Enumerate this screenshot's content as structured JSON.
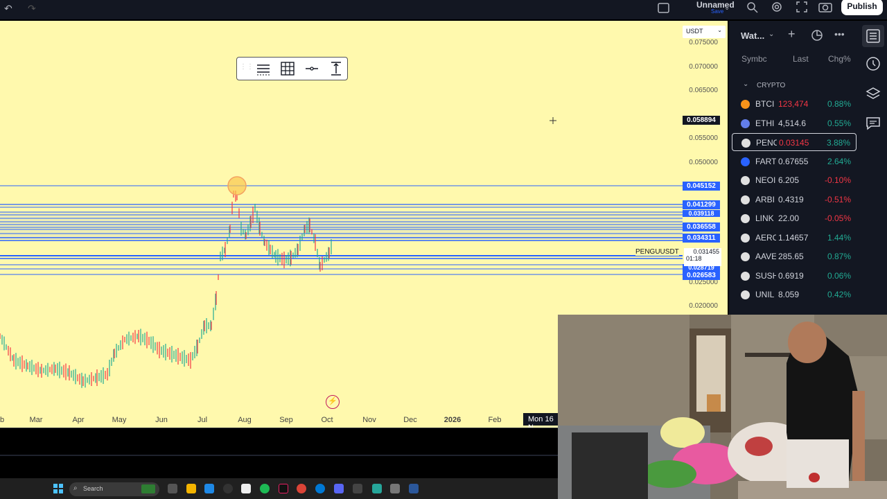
{
  "topbar": {
    "layout_name": "Unnamed",
    "save_label": "Save",
    "publish_label": "Publish",
    "icons": [
      "undo-icon",
      "redo-icon",
      "fullscreen-toggle-icon",
      "chevron-down-icon",
      "search-icon",
      "settings-icon",
      "fullscreen-icon",
      "camera-icon"
    ]
  },
  "chart": {
    "currency": "USDT",
    "symbol": "PENGUUSDT",
    "symbol_price": "0.031455",
    "countdown": "01:18",
    "crosshair_price": "0.058894",
    "crosshair_date": "Mon 16 N",
    "price_ticks": [
      "0.075000",
      "0.070000",
      "0.065000",
      "0.055000",
      "0.050000",
      "0.025000",
      "0.020000"
    ],
    "time_labels": [
      "b",
      "Mar",
      "Apr",
      "May",
      "Jun",
      "Jul",
      "Aug",
      "Sep",
      "Oct",
      "Nov",
      "Dec",
      "2026",
      "Feb"
    ],
    "level_badges": [
      "0.045152",
      "0.041299",
      "0.039118",
      "0.036558",
      "0.034311",
      "0.026583"
    ],
    "hidden_badge": "0.028719",
    "line_color": "#2962ff",
    "background": "#fff9ad"
  },
  "watchlist": {
    "title": "Wat...",
    "columns": [
      "Symbc",
      "Last",
      "Chg%"
    ],
    "section": "CRYPTO",
    "rows": [
      {
        "sym": "BTCI",
        "last": "123,474",
        "chg": "0.88%",
        "up": false,
        "dot": "#f7931a"
      },
      {
        "sym": "ETHI",
        "last": "4,514.6",
        "chg": "0.55%",
        "up": true,
        "dot": "#627eea"
      },
      {
        "sym": "PENC",
        "last": "0.03145",
        "chg": "3.88%",
        "up": false,
        "dot": "#e0e0e0",
        "sel": true
      },
      {
        "sym": "FART",
        "last": "0.67655",
        "chg": "2.64%",
        "up": true,
        "dot": "#2962ff"
      },
      {
        "sym": "NEOI",
        "last": "6.205",
        "chg": "-0.10%",
        "up": true,
        "dot": "#e0e0e0"
      },
      {
        "sym": "ARBI",
        "last": "0.4319",
        "chg": "-0.51%",
        "up": true,
        "dot": "#e0e0e0"
      },
      {
        "sym": "LINK",
        "last": "22.00",
        "chg": "-0.05%",
        "up": true,
        "dot": "#e0e0e0"
      },
      {
        "sym": "AERC",
        "last": "1.14657",
        "chg": "1.44%",
        "up": true,
        "dot": "#e0e0e0"
      },
      {
        "sym": "AAVE",
        "last": "285.65",
        "chg": "0.87%",
        "up": true,
        "dot": "#e0e0e0"
      },
      {
        "sym": "SUSH",
        "last": "0.6919",
        "chg": "0.06%",
        "up": true,
        "dot": "#e0e0e0"
      },
      {
        "sym": "UNIL",
        "last": "8.059",
        "chg": "0.42%",
        "up": true,
        "dot": "#e0e0e0"
      }
    ]
  },
  "taskbar": {
    "search_placeholder": "Search"
  }
}
